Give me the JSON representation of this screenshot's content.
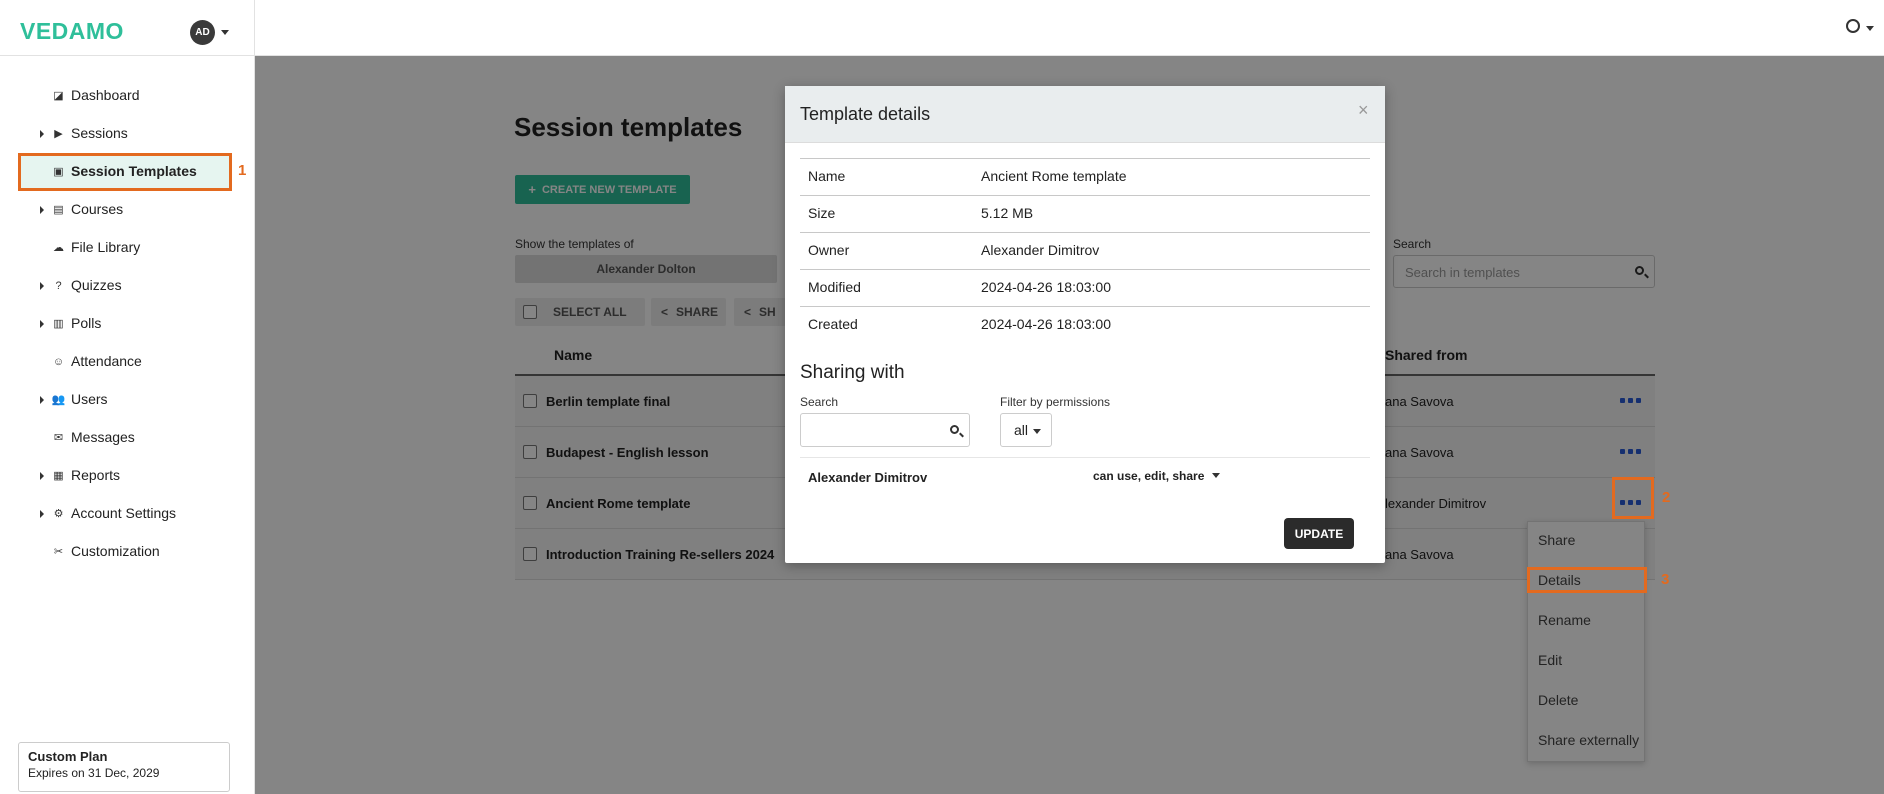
{
  "app": {
    "logo": "VEDAMO",
    "user_initials": "AD"
  },
  "sidebar": {
    "items": [
      {
        "label": "Dashboard",
        "icon": "dashboard-icon",
        "expandable": false
      },
      {
        "label": "Sessions",
        "icon": "play-circle-icon",
        "expandable": true
      },
      {
        "label": "Session Templates",
        "icon": "template-icon",
        "expandable": false,
        "active": true
      },
      {
        "label": "Courses",
        "icon": "book-icon",
        "expandable": true
      },
      {
        "label": "File Library",
        "icon": "cloud-icon",
        "expandable": false
      },
      {
        "label": "Quizzes",
        "icon": "question-icon",
        "expandable": true
      },
      {
        "label": "Polls",
        "icon": "bar-chart-icon",
        "expandable": true
      },
      {
        "label": "Attendance",
        "icon": "user-check-icon",
        "expandable": false
      },
      {
        "label": "Users",
        "icon": "users-icon",
        "expandable": true
      },
      {
        "label": "Messages",
        "icon": "envelope-icon",
        "expandable": false
      },
      {
        "label": "Reports",
        "icon": "report-icon",
        "expandable": true
      },
      {
        "label": "Account Settings",
        "icon": "gear-icon",
        "expandable": true
      },
      {
        "label": "Customization",
        "icon": "tools-icon",
        "expandable": false
      }
    ],
    "plan": {
      "title": "Custom Plan",
      "expires": "Expires on 31 Dec, 2029"
    }
  },
  "annotations": {
    "step1": "1",
    "step2": "2",
    "step3": "3"
  },
  "main": {
    "title": "Session templates",
    "create_button": "CREATE NEW TEMPLATE",
    "show_label": "Show the templates of",
    "show_value": "Alexander Dolton",
    "search_label": "Search",
    "search_placeholder": "Search in templates",
    "toolbar": {
      "select_all": "SELECT ALL",
      "share": "SHARE",
      "share2": "SH"
    },
    "columns": {
      "name": "Name",
      "shared_from": "Shared from"
    },
    "rows": [
      {
        "name": "Berlin template final",
        "shared_from": "ana Savova"
      },
      {
        "name": "Budapest - English lesson",
        "shared_from": "ana Savova"
      },
      {
        "name": "Ancient Rome template",
        "shared_from": "lexander Dimitrov"
      },
      {
        "name": "Introduction Training Re-sellers 2024",
        "shared_from": "ana Savova"
      }
    ],
    "context_menu": [
      "Share",
      "Details",
      "Rename",
      "Edit",
      "Delete",
      "Share externally"
    ]
  },
  "modal": {
    "title": "Template details",
    "close": "×",
    "details": [
      {
        "key": "Name",
        "value": "Ancient Rome template"
      },
      {
        "key": "Size",
        "value": "5.12 MB"
      },
      {
        "key": "Owner",
        "value": "Alexander Dimitrov"
      },
      {
        "key": "Modified",
        "value": "2024-04-26 18:03:00"
      },
      {
        "key": "Created",
        "value": "2024-04-26 18:03:00"
      }
    ],
    "sharing_heading": "Sharing with",
    "search_label": "Search",
    "filter_label": "Filter by permissions",
    "filter_value": "all",
    "shared_user": "Alexander Dimitrov",
    "shared_permissions": "can use, edit, share",
    "update_button": "UPDATE"
  },
  "colors": {
    "brand": "#2fbf9a",
    "annotation": "#e36a1f",
    "link_dots": "#2a5bd7"
  }
}
